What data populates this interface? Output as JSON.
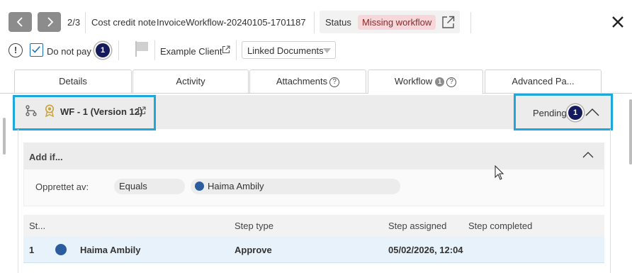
{
  "header": {
    "page_counter": "2/3",
    "doc_type": "Cost credit note",
    "doc_name": "InvoiceWorkflow-20240105-1701187",
    "status_label": "Status",
    "status_value": "Missing workflow"
  },
  "toolbar": {
    "info_glyph": "!",
    "do_not_pay_label": "Do not pay",
    "do_not_pay_checked": true,
    "do_not_pay_count": "1",
    "client_link": "Example Client",
    "linked_documents": "Linked Documents"
  },
  "tabs": [
    {
      "label": "Details"
    },
    {
      "label": "Activity"
    },
    {
      "label": "Attachments",
      "help": "?"
    },
    {
      "label": "Workflow",
      "count": "1",
      "help": "?"
    },
    {
      "label": "Advanced Pa..."
    }
  ],
  "workflow": {
    "title": "WF - 1 (Version 12)",
    "status": "Pending",
    "status_count": "1",
    "add_if_label": "Add if...",
    "condition": {
      "field": "Opprettet av:",
      "operator": "Equals",
      "value": "Haima Ambily"
    },
    "table": {
      "headers": [
        "St...",
        "",
        "Step type",
        "Step assigned",
        "Step completed"
      ],
      "rows": [
        {
          "step": "1",
          "name": "Haima Ambily",
          "type": "Approve",
          "assigned": "05/02/2026, 12:04",
          "completed": ""
        }
      ]
    }
  },
  "colors": {
    "highlight": "#1ea7d8",
    "badge": "#151a5c",
    "status_badge_bg": "#f8d7da",
    "row_selected": "#e8f2fa"
  },
  "icons": [
    "chevron-left-icon",
    "chevron-right-icon",
    "external-link-icon",
    "close-icon",
    "info-icon",
    "checkbox-icon",
    "flag-icon",
    "dropdown-arrow-icon",
    "workflow-tree-icon",
    "award-icon",
    "chevron-up-icon",
    "person-icon"
  ]
}
